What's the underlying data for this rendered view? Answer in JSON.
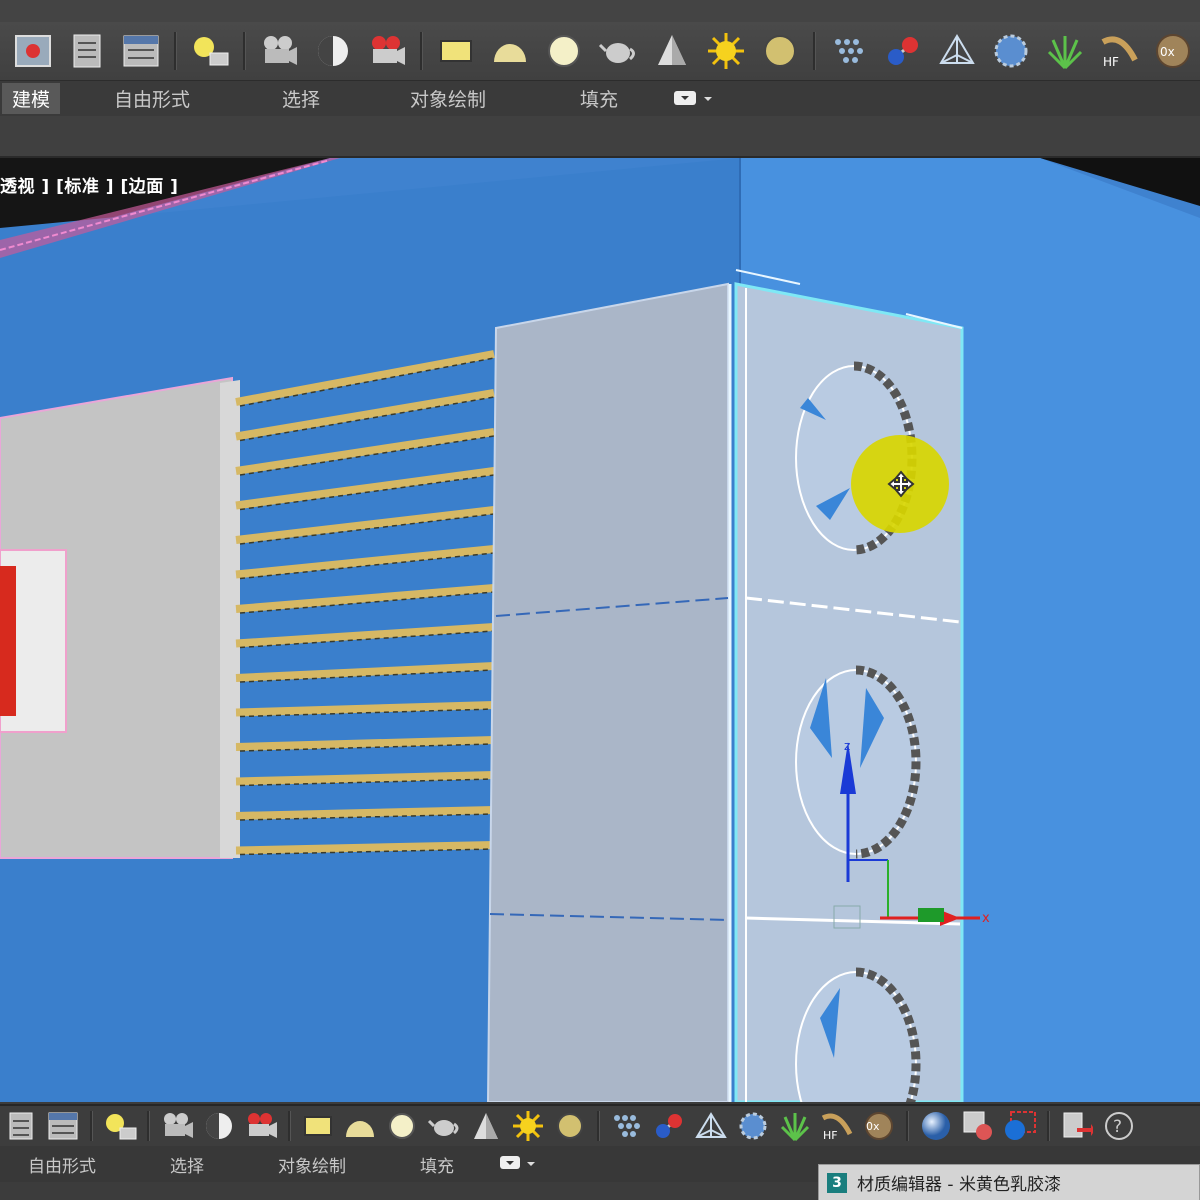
{
  "top_toolbar": {
    "icons": [
      "render-frame-icon",
      "scene-explorer-icon",
      "layer-manager-icon",
      "light-icon",
      "camera-icon",
      "omni-light-icon",
      "video-camera-icon",
      "plane-icon",
      "hemisphere-icon",
      "sphere-icon",
      "teapot-icon",
      "cone-icon",
      "sun-icon",
      "geosphere-icon",
      "grid-dots-icon",
      "molecule-icon",
      "pyramid-icon",
      "gear-flower-icon",
      "grass-icon",
      "hair-icon",
      "wood-sphere-icon"
    ],
    "hf_label": "HF",
    "ox_label": "0x"
  },
  "ribbon_tabs": [
    {
      "label": "建模",
      "active": true
    },
    {
      "label": "自由形式",
      "active": false
    },
    {
      "label": "选择",
      "active": false
    },
    {
      "label": "对象绘制",
      "active": false
    },
    {
      "label": "填充",
      "active": false
    }
  ],
  "ribbon_dropdown_icon": "▾",
  "viewport": {
    "label": "透视 ] [标准 ] [边面 ]",
    "background": "#3f82cf"
  },
  "bottom_tabs": [
    {
      "label": "自由形式"
    },
    {
      "label": "选择"
    },
    {
      "label": "对象绘制"
    },
    {
      "label": "填充"
    }
  ],
  "bottom_toolbar": {
    "hf_label": "HF",
    "ox_label": "0x",
    "help_label": "?"
  },
  "taskbar": {
    "badge": "3",
    "title": "材质编辑器 - 米黄色乳胶漆"
  },
  "colors": {
    "accent_yellow": "#d8d600",
    "slat_gold": "#d6b864",
    "axis_x": "#e02020",
    "axis_z": "#1a3ad6"
  }
}
